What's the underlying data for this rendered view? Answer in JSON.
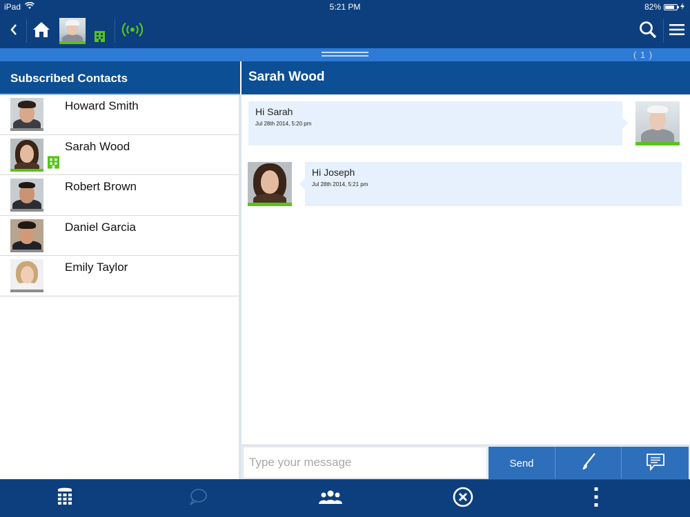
{
  "status_bar": {
    "device": "iPad",
    "time": "5:21 PM",
    "battery": "82%",
    "battery_level": 0.82
  },
  "toolbar": {
    "back_icon": "chevron-left-icon",
    "home_icon": "home-icon",
    "presence_icon": "building-icon",
    "connection_icon": "broadcast-icon",
    "search_icon": "search-icon",
    "menu_icon": "hamburger-menu-icon",
    "colors": {
      "background": "#0d3f7e",
      "online": "#59c31a"
    }
  },
  "splitter": {
    "count": "( 1 )"
  },
  "contacts": {
    "title": "Subscribed Contacts",
    "items": [
      {
        "name": "Howard Smith",
        "online": false,
        "at_office": false
      },
      {
        "name": "Sarah Wood",
        "online": true,
        "at_office": true
      },
      {
        "name": "Robert Brown",
        "online": false,
        "at_office": false
      },
      {
        "name": "Daniel Garcia",
        "online": false,
        "at_office": false
      },
      {
        "name": "Emily Taylor",
        "online": false,
        "at_office": false
      }
    ]
  },
  "conversation": {
    "title": "Sarah Wood",
    "messages": [
      {
        "direction": "out",
        "text": "Hi Sarah",
        "time": "Jul 28th 2014, 5:20 pm"
      },
      {
        "direction": "in",
        "text": "Hi Joseph",
        "time": "Jul 28th 2014, 5:21 pm"
      }
    ]
  },
  "composer": {
    "placeholder": "Type your message",
    "send_label": "Send",
    "brush_icon": "paintbrush-icon",
    "chat_icon": "chat-bubble-icon"
  },
  "bottom_bar": {
    "icons": [
      "dialpad-icon",
      "chat-icon",
      "group-icon",
      "close-circle-icon",
      "more-vertical-icon"
    ]
  }
}
